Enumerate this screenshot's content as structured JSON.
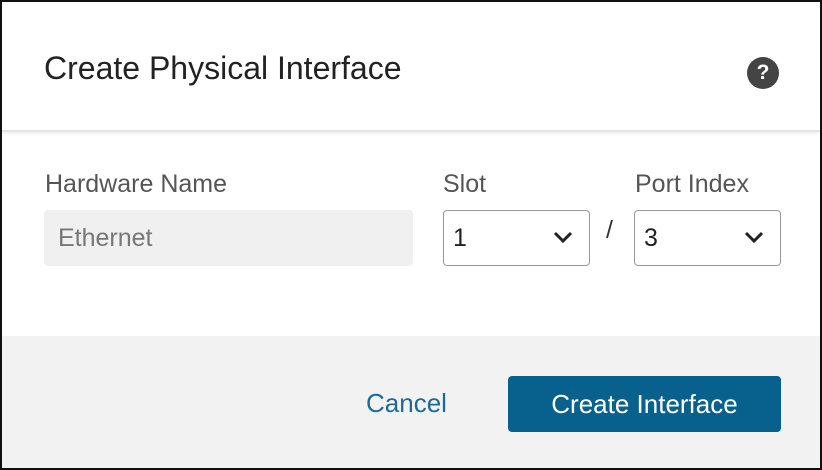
{
  "dialog": {
    "title": "Create Physical Interface",
    "help_icon": "?"
  },
  "form": {
    "hardware_label": "Hardware Name",
    "hardware_value": "Ethernet",
    "slot_label": "Slot",
    "slot_value": "1",
    "separator": "/",
    "port_label": "Port Index",
    "port_value": "3"
  },
  "footer": {
    "cancel": "Cancel",
    "create": "Create Interface"
  }
}
